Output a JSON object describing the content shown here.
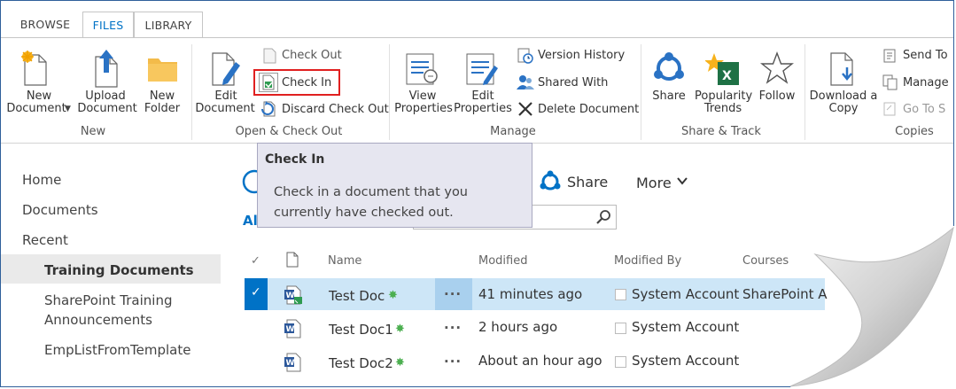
{
  "tabs": [
    "BROWSE",
    "FILES",
    "LIBRARY"
  ],
  "ribbon": {
    "new_document": [
      "New",
      "Document"
    ],
    "upload_document": [
      "Upload",
      "Document"
    ],
    "new_folder": [
      "New",
      "Folder"
    ],
    "group_new": "New",
    "edit_document": [
      "Edit",
      "Document"
    ],
    "check_out": "Check Out",
    "check_in": "Check In",
    "discard_check_out": "Discard Check Out",
    "group_open": "Open & Check Out",
    "view_properties": [
      "View",
      "Properties"
    ],
    "edit_properties": [
      "Edit",
      "Properties"
    ],
    "version_history": "Version History",
    "shared_with": "Shared With",
    "delete_document": "Delete Document",
    "group_manage": "Manage",
    "share": "Share",
    "popularity_trends": [
      "Popularity",
      "Trends"
    ],
    "follow": "Follow",
    "group_share": "Share & Track",
    "download_copy": [
      "Download a",
      "Copy"
    ],
    "send_to": "Send To",
    "manage_copies": "Manage",
    "go_to_source": "Go To S",
    "group_copies": "Copies"
  },
  "tooltip": {
    "title": "Check In",
    "body_line1": "Check in a document that you",
    "body_line2": "currently have checked out."
  },
  "nav": [
    "Home",
    "Documents",
    "Recent",
    "Training Documents",
    "SharePoint Training",
    "Announcements",
    "EmpListFromTemplate"
  ],
  "toolbar": {
    "share": "Share",
    "more": "More",
    "all_label": "Al"
  },
  "columns": {
    "name": "Name",
    "modified": "Modified",
    "modified_by": "Modified By",
    "courses": "Courses"
  },
  "rows": [
    {
      "name": "Test Doc",
      "modified": "41 minutes ago",
      "modified_by": "System Account",
      "courses": "SharePoint A"
    },
    {
      "name": "Test Doc1",
      "modified": "2 hours ago",
      "modified_by": "System Account",
      "courses": ""
    },
    {
      "name": "Test Doc2",
      "modified": "About an hour ago",
      "modified_by": "System Account",
      "courses": ""
    }
  ],
  "colors": {
    "accent": "#0072c6",
    "selected_row": "#cde6f7",
    "highlight_box": "#e02020"
  }
}
